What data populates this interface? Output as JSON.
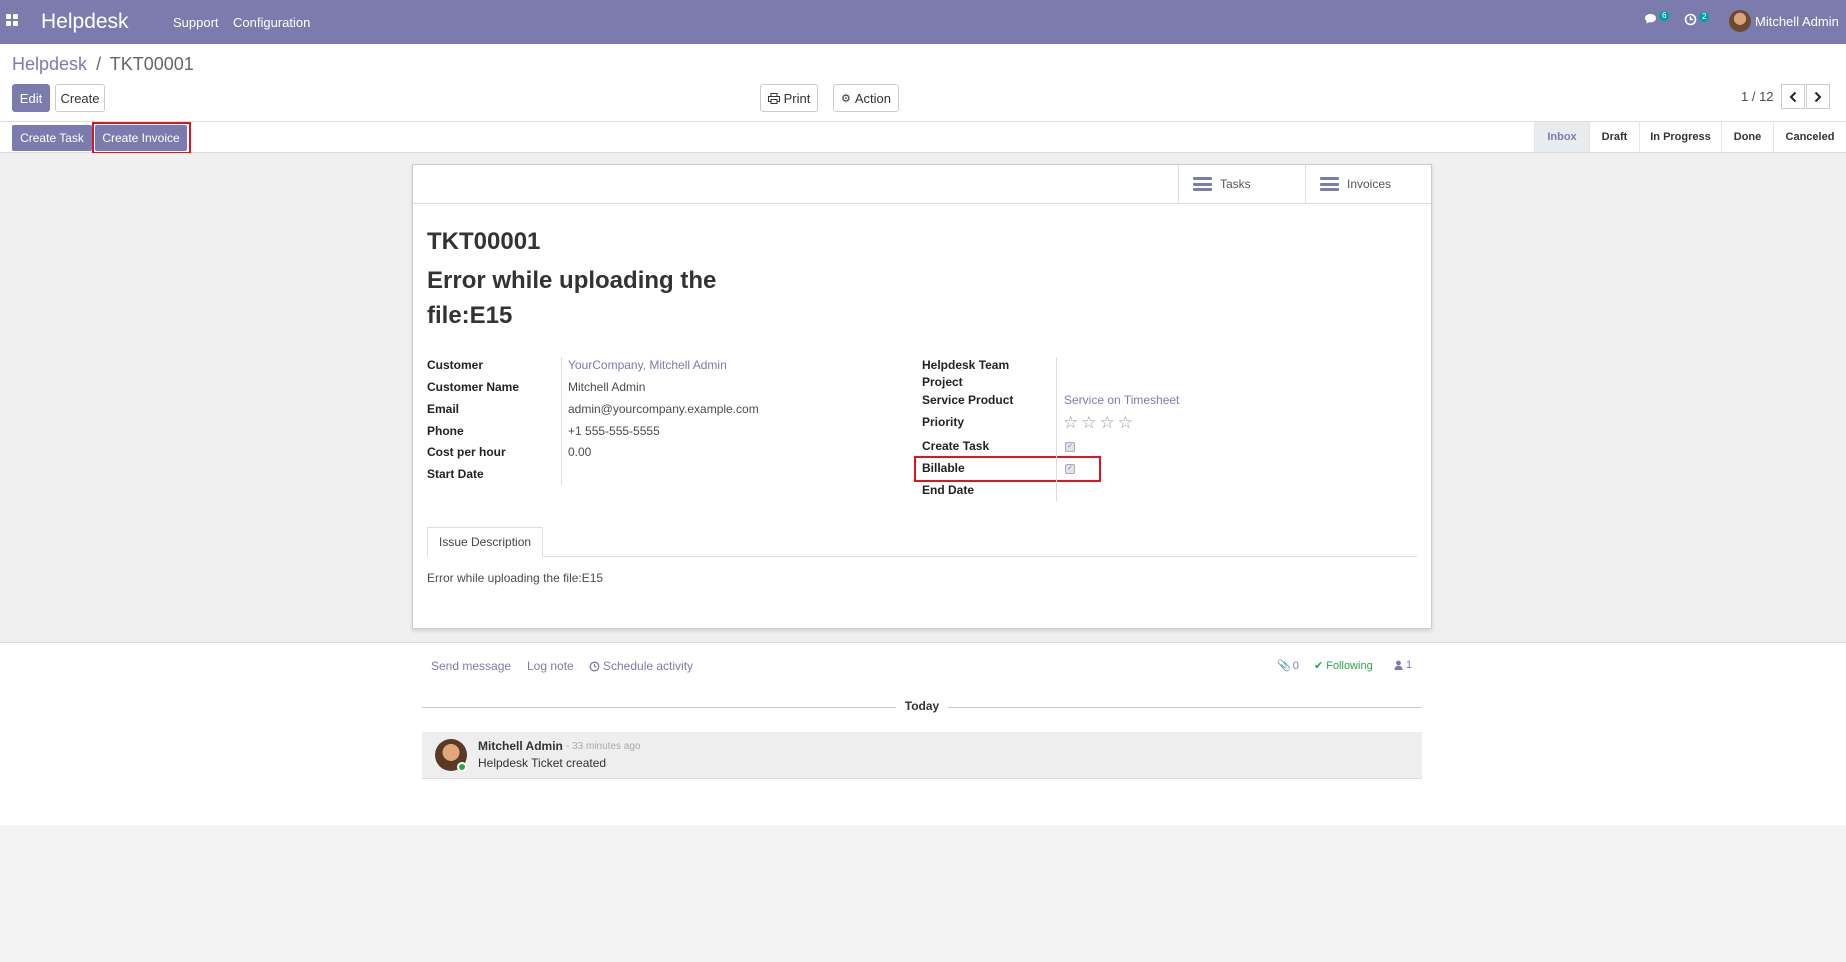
{
  "app": {
    "brand": "Helpdesk"
  },
  "nav": {
    "menu": [
      "Support",
      "Configuration"
    ],
    "messages_count": "6",
    "activities_count": "2",
    "user_name": "Mitchell Admin"
  },
  "breadcrumb": {
    "parent": "Helpdesk",
    "separator": "/",
    "current": "TKT00001"
  },
  "control": {
    "edit_label": "Edit",
    "create_label": "Create",
    "print_label": "Print",
    "action_label": "Action",
    "pager": "1 / 12"
  },
  "statusbar": {
    "create_task_label": "Create Task",
    "create_invoice_label": "Create Invoice",
    "stages": [
      "Inbox",
      "Draft",
      "In Progress",
      "Done",
      "Canceled"
    ],
    "active_stage": "Inbox"
  },
  "smart_buttons": {
    "tasks": "Tasks",
    "invoices": "Invoices"
  },
  "ticket": {
    "reference": "TKT00001",
    "title": "Error while uploading the file:E15",
    "left_fields": {
      "customer_label": "Customer",
      "customer_value": "YourCompany, Mitchell Admin",
      "customer_name_label": "Customer Name",
      "customer_name_value": "Mitchell Admin",
      "email_label": "Email",
      "email_value": "admin@yourcompany.example.com",
      "phone_label": "Phone",
      "phone_value": "+1 555-555-5555",
      "cost_label": "Cost per hour",
      "cost_value": "0.00",
      "start_date_label": "Start Date"
    },
    "right_fields": {
      "team_label": "Helpdesk Team",
      "project_label": "Project",
      "service_label": "Service Product",
      "service_value": "Service on Timesheet",
      "priority_label": "Priority",
      "priority_stars": 0,
      "priority_max": 4,
      "create_task_label": "Create Task",
      "create_task_checked": true,
      "billable_label": "Billable",
      "billable_checked": true,
      "end_date_label": "End Date"
    },
    "tab_label": "Issue Description",
    "description": "Error while uploading the file:E15"
  },
  "chatter": {
    "send_message": "Send message",
    "log_note": "Log note",
    "schedule_activity": "Schedule activity",
    "attachments": "0",
    "following": "Following",
    "followers": "1",
    "day_separator": "Today",
    "message": {
      "author": "Mitchell Admin",
      "time": "- 33 minutes ago",
      "body": "Helpdesk Ticket created"
    }
  },
  "colors": {
    "brand": "#7c7bad",
    "highlight": "#e0141e",
    "online": "#28a745"
  }
}
